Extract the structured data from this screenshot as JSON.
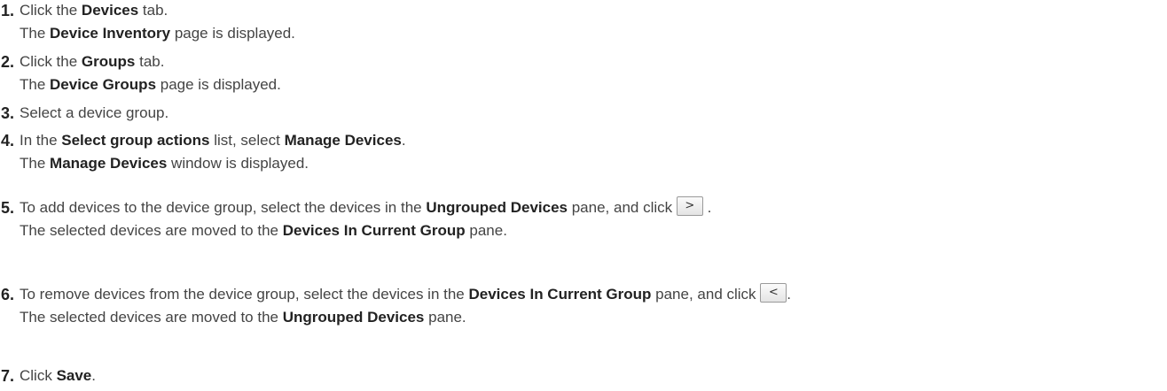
{
  "steps": [
    {
      "number": "1.",
      "line1": {
        "a": "Click the ",
        "b": "Devices",
        "c": " tab."
      },
      "line2": {
        "a": "The ",
        "b": "Device Inventory",
        "c": " page is displayed."
      }
    },
    {
      "number": "2.",
      "line1": {
        "a": "Click the ",
        "b": "Groups",
        "c": " tab."
      },
      "line2": {
        "a": "The ",
        "b": "Device Groups",
        "c": " page is displayed."
      }
    },
    {
      "number": "3.",
      "line1": {
        "a": "Select a device group."
      }
    },
    {
      "number": "4.",
      "line1": {
        "a": "In the ",
        "b": "Select group actions",
        "c": " list, select ",
        "d": "Manage Devices",
        "e": "."
      },
      "line2": {
        "a": "The ",
        "b": "Manage Devices",
        "c": " window is displayed."
      }
    },
    {
      "number": "5.",
      "line1": {
        "a": "To add devices to the device group, select the devices in the ",
        "b": "Ungrouped Devices",
        "c": " pane, and click ",
        "icon": ">",
        "d": " ."
      },
      "line2": {
        "a": "The selected devices are moved to the ",
        "b": "Devices In Current Group",
        "c": " pane."
      }
    },
    {
      "number": "6.",
      "line1": {
        "a": "To remove devices from the device group, select the devices in the ",
        "b": "Devices In Current Group",
        "c": " pane, and click ",
        "icon": "<",
        "d": "."
      },
      "line2": {
        "a": "The selected devices are moved to the ",
        "b": "Ungrouped Devices",
        "c": " pane."
      }
    },
    {
      "number": "7.",
      "line1": {
        "a": "Click ",
        "b": "Save",
        "c": "."
      }
    }
  ]
}
